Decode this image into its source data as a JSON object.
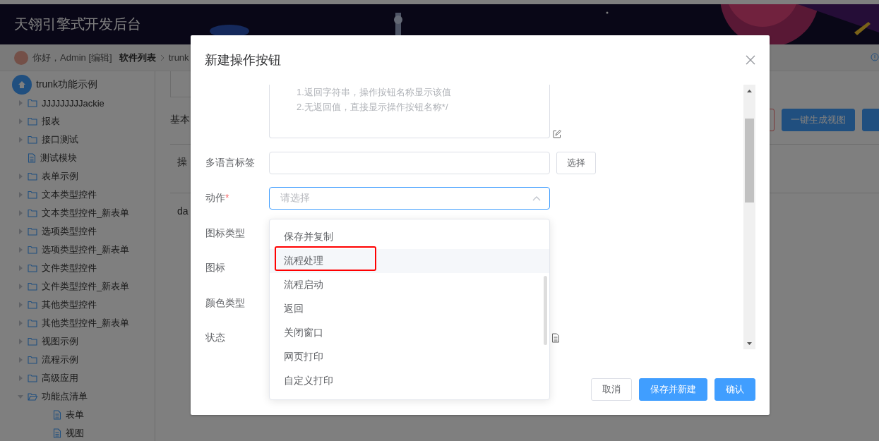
{
  "header": {
    "title": "天翎引擎式开发后台"
  },
  "breadcrumb": {
    "greeting": "你好，Admin [编辑]",
    "crumbs": [
      "软件列表",
      "trunk"
    ]
  },
  "sidebar": {
    "root": "trunk功能示例",
    "items": [
      {
        "label": "JJJJJJJJJackie",
        "kind": "folder",
        "expanded": false
      },
      {
        "label": "报表",
        "kind": "folder",
        "expanded": false
      },
      {
        "label": "接口测试",
        "kind": "folder",
        "expanded": false
      },
      {
        "label": "测试模块",
        "kind": "file"
      },
      {
        "label": "表单示例",
        "kind": "folder",
        "expanded": false
      },
      {
        "label": "文本类型控件",
        "kind": "folder",
        "expanded": false
      },
      {
        "label": "文本类型控件_新表单",
        "kind": "folder",
        "expanded": false
      },
      {
        "label": "选项类型控件",
        "kind": "folder",
        "expanded": false
      },
      {
        "label": "选项类型控件_新表单",
        "kind": "folder",
        "expanded": false
      },
      {
        "label": "文件类型控件",
        "kind": "folder",
        "expanded": false
      },
      {
        "label": "文件类型控件_新表单",
        "kind": "folder",
        "expanded": false
      },
      {
        "label": "其他类型控件",
        "kind": "folder",
        "expanded": false
      },
      {
        "label": "其他类型控件_新表单",
        "kind": "folder",
        "expanded": false
      },
      {
        "label": "视图示例",
        "kind": "folder",
        "expanded": false
      },
      {
        "label": "流程示例",
        "kind": "folder",
        "expanded": false
      },
      {
        "label": "高级应用",
        "kind": "folder",
        "expanded": false
      },
      {
        "label": "功能点清单",
        "kind": "folder",
        "expanded": true,
        "children": [
          {
            "label": "表单",
            "kind": "file"
          },
          {
            "label": "视图",
            "kind": "file"
          }
        ]
      }
    ]
  },
  "main": {
    "section": "基本",
    "buttons": [
      {
        "kind": "danger"
      },
      {
        "label": "一键生成视图",
        "kind": "primary"
      },
      {
        "kind": "primary"
      }
    ],
    "rows": [
      "操",
      "da"
    ]
  },
  "dialog": {
    "title": "新建操作按钮",
    "textarea_lines": [
      "1.返回字符串，操作按钮名称显示该值",
      "2.无返回值，直接显示操作按钮名称*/"
    ],
    "fields": [
      {
        "label": "多语言标签",
        "kind": "input",
        "button": "选择"
      },
      {
        "label": "动作",
        "kind": "select",
        "required_mark": "*",
        "placeholder": "请选择",
        "open": true
      },
      {
        "label": "图标类型",
        "kind": "covered"
      },
      {
        "label": "图标",
        "kind": "covered"
      },
      {
        "label": "颜色类型",
        "kind": "covered"
      },
      {
        "label": "状态",
        "kind": "doc"
      }
    ],
    "dropdown": [
      {
        "label": "保存并复制",
        "highlighted": false,
        "annotated": false
      },
      {
        "label": "流程处理",
        "highlighted": true,
        "annotated": true
      },
      {
        "label": "流程启动",
        "highlighted": false,
        "annotated": false
      },
      {
        "label": "返回",
        "highlighted": false,
        "annotated": false
      },
      {
        "label": "关闭窗口",
        "highlighted": false,
        "annotated": false
      },
      {
        "label": "网页打印",
        "highlighted": false,
        "annotated": false
      },
      {
        "label": "自定义打印",
        "highlighted": false,
        "annotated": false
      }
    ],
    "buttons": [
      {
        "label": "取消",
        "kind": "default"
      },
      {
        "label": "保存并新建",
        "kind": "primary"
      },
      {
        "label": "确认",
        "kind": "primary"
      }
    ]
  }
}
